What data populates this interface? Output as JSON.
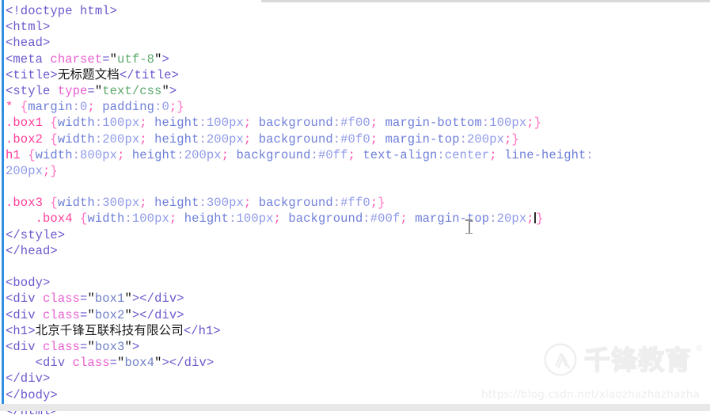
{
  "app": {
    "type": "code-editor",
    "language": "html",
    "theme": "light"
  },
  "code": {
    "lines": [
      {
        "id": "l1",
        "name": "code-line-doctype",
        "tokens": [
          {
            "t": "tag",
            "v": "<!doctype html>"
          }
        ]
      },
      {
        "id": "l2",
        "name": "code-line-html-open",
        "tokens": [
          {
            "t": "tag",
            "v": "<html>"
          }
        ]
      },
      {
        "id": "l3",
        "name": "code-line-head-open",
        "tokens": [
          {
            "t": "tag",
            "v": "<head>"
          }
        ]
      },
      {
        "id": "l4",
        "name": "code-line-meta-charset",
        "tokens": [
          {
            "t": "tag",
            "v": "<meta "
          },
          {
            "t": "attr",
            "v": "charset"
          },
          {
            "t": "tag",
            "v": "="
          },
          {
            "t": "quote",
            "v": "\""
          },
          {
            "t": "strgreen",
            "v": "utf-8"
          },
          {
            "t": "quote",
            "v": "\""
          },
          {
            "t": "tag",
            "v": ">"
          }
        ]
      },
      {
        "id": "l5",
        "name": "code-line-title",
        "tokens": [
          {
            "t": "tag",
            "v": "<title>"
          },
          {
            "t": "text",
            "v": "无标题文档"
          },
          {
            "t": "tag",
            "v": "</title>"
          }
        ]
      },
      {
        "id": "l6",
        "name": "code-line-style-open",
        "tokens": [
          {
            "t": "tag",
            "v": "<style "
          },
          {
            "t": "attr",
            "v": "type"
          },
          {
            "t": "tag",
            "v": "="
          },
          {
            "t": "quote",
            "v": "\""
          },
          {
            "t": "strgreen",
            "v": "text/css"
          },
          {
            "t": "quote",
            "v": "\""
          },
          {
            "t": "tag",
            "v": ">"
          }
        ]
      },
      {
        "id": "l7",
        "name": "code-line-css-universal",
        "tokens": [
          {
            "t": "sel",
            "v": "*"
          },
          {
            "t": "text",
            "v": " "
          },
          {
            "t": "brace",
            "v": "{"
          },
          {
            "t": "prop",
            "v": "margin"
          },
          {
            "t": "colon",
            "v": ":"
          },
          {
            "t": "val",
            "v": "0"
          },
          {
            "t": "semi",
            "v": ";"
          },
          {
            "t": "text",
            "v": " "
          },
          {
            "t": "prop",
            "v": "padding"
          },
          {
            "t": "colon",
            "v": ":"
          },
          {
            "t": "val",
            "v": "0"
          },
          {
            "t": "semi",
            "v": ";"
          },
          {
            "t": "brace",
            "v": "}"
          }
        ]
      },
      {
        "id": "l8",
        "name": "code-line-css-box1",
        "tokens": [
          {
            "t": "sel",
            "v": ".box1"
          },
          {
            "t": "text",
            "v": " "
          },
          {
            "t": "brace",
            "v": "{"
          },
          {
            "t": "prop",
            "v": "width"
          },
          {
            "t": "colon",
            "v": ":"
          },
          {
            "t": "val",
            "v": "100px"
          },
          {
            "t": "semi",
            "v": ";"
          },
          {
            "t": "text",
            "v": " "
          },
          {
            "t": "prop",
            "v": "height"
          },
          {
            "t": "colon",
            "v": ":"
          },
          {
            "t": "val",
            "v": "100px"
          },
          {
            "t": "semi",
            "v": ";"
          },
          {
            "t": "text",
            "v": " "
          },
          {
            "t": "prop",
            "v": "background"
          },
          {
            "t": "colon",
            "v": ":"
          },
          {
            "t": "val",
            "v": "#f00"
          },
          {
            "t": "semi",
            "v": ";"
          },
          {
            "t": "text",
            "v": " "
          },
          {
            "t": "prop",
            "v": "margin-bottom"
          },
          {
            "t": "colon",
            "v": ":"
          },
          {
            "t": "val",
            "v": "100px"
          },
          {
            "t": "semi",
            "v": ";"
          },
          {
            "t": "brace",
            "v": "}"
          }
        ]
      },
      {
        "id": "l9",
        "name": "code-line-css-box2",
        "tokens": [
          {
            "t": "sel",
            "v": ".box2"
          },
          {
            "t": "text",
            "v": " "
          },
          {
            "t": "brace",
            "v": "{"
          },
          {
            "t": "prop",
            "v": "width"
          },
          {
            "t": "colon",
            "v": ":"
          },
          {
            "t": "val",
            "v": "200px"
          },
          {
            "t": "semi",
            "v": ";"
          },
          {
            "t": "text",
            "v": " "
          },
          {
            "t": "prop",
            "v": "height"
          },
          {
            "t": "colon",
            "v": ":"
          },
          {
            "t": "val",
            "v": "200px"
          },
          {
            "t": "semi",
            "v": ";"
          },
          {
            "t": "text",
            "v": " "
          },
          {
            "t": "prop",
            "v": "background"
          },
          {
            "t": "colon",
            "v": ":"
          },
          {
            "t": "val",
            "v": "#0f0"
          },
          {
            "t": "semi",
            "v": ";"
          },
          {
            "t": "text",
            "v": " "
          },
          {
            "t": "prop",
            "v": "margin-top"
          },
          {
            "t": "colon",
            "v": ":"
          },
          {
            "t": "val",
            "v": "200px"
          },
          {
            "t": "semi",
            "v": ";"
          },
          {
            "t": "brace",
            "v": "}"
          }
        ]
      },
      {
        "id": "l10",
        "name": "code-line-css-h1-part1",
        "tokens": [
          {
            "t": "sel",
            "v": "h1"
          },
          {
            "t": "text",
            "v": " "
          },
          {
            "t": "brace",
            "v": "{"
          },
          {
            "t": "prop",
            "v": "width"
          },
          {
            "t": "colon",
            "v": ":"
          },
          {
            "t": "val",
            "v": "800px"
          },
          {
            "t": "semi",
            "v": ";"
          },
          {
            "t": "text",
            "v": " "
          },
          {
            "t": "prop",
            "v": "height"
          },
          {
            "t": "colon",
            "v": ":"
          },
          {
            "t": "val",
            "v": "200px"
          },
          {
            "t": "semi",
            "v": ";"
          },
          {
            "t": "text",
            "v": " "
          },
          {
            "t": "prop",
            "v": "background"
          },
          {
            "t": "colon",
            "v": ":"
          },
          {
            "t": "val",
            "v": "#0ff"
          },
          {
            "t": "semi",
            "v": ";"
          },
          {
            "t": "text",
            "v": " "
          },
          {
            "t": "prop",
            "v": "text-align"
          },
          {
            "t": "colon",
            "v": ":"
          },
          {
            "t": "val",
            "v": "center"
          },
          {
            "t": "semi",
            "v": ";"
          },
          {
            "t": "text",
            "v": " "
          },
          {
            "t": "prop",
            "v": "line-height"
          },
          {
            "t": "colon",
            "v": ":"
          }
        ]
      },
      {
        "id": "l11",
        "name": "code-line-css-h1-part2",
        "tokens": [
          {
            "t": "val",
            "v": "200px"
          },
          {
            "t": "semi",
            "v": ";"
          },
          {
            "t": "brace",
            "v": "}"
          }
        ]
      },
      {
        "id": "l12",
        "name": "code-line-blank-1",
        "tokens": []
      },
      {
        "id": "l13",
        "name": "code-line-css-box3",
        "tokens": [
          {
            "t": "sel",
            "v": ".box3"
          },
          {
            "t": "text",
            "v": " "
          },
          {
            "t": "brace",
            "v": "{"
          },
          {
            "t": "prop",
            "v": "width"
          },
          {
            "t": "colon",
            "v": ":"
          },
          {
            "t": "val",
            "v": "300px"
          },
          {
            "t": "semi",
            "v": ";"
          },
          {
            "t": "text",
            "v": " "
          },
          {
            "t": "prop",
            "v": "height"
          },
          {
            "t": "colon",
            "v": ":"
          },
          {
            "t": "val",
            "v": "300px"
          },
          {
            "t": "semi",
            "v": ";"
          },
          {
            "t": "text",
            "v": " "
          },
          {
            "t": "prop",
            "v": "background"
          },
          {
            "t": "colon",
            "v": ":"
          },
          {
            "t": "val",
            "v": "#ff0"
          },
          {
            "t": "semi",
            "v": ";"
          },
          {
            "t": "brace",
            "v": "}"
          }
        ]
      },
      {
        "id": "l14",
        "name": "code-line-css-box4",
        "tokens": [
          {
            "t": "text",
            "v": "    "
          },
          {
            "t": "sel",
            "v": ".box4"
          },
          {
            "t": "text",
            "v": " "
          },
          {
            "t": "brace",
            "v": "{"
          },
          {
            "t": "prop",
            "v": "width"
          },
          {
            "t": "colon",
            "v": ":"
          },
          {
            "t": "val",
            "v": "100px"
          },
          {
            "t": "semi",
            "v": ";"
          },
          {
            "t": "text",
            "v": " "
          },
          {
            "t": "prop",
            "v": "height"
          },
          {
            "t": "colon",
            "v": ":"
          },
          {
            "t": "val",
            "v": "100px"
          },
          {
            "t": "semi",
            "v": ";"
          },
          {
            "t": "text",
            "v": " "
          },
          {
            "t": "prop",
            "v": "background"
          },
          {
            "t": "colon",
            "v": ":"
          },
          {
            "t": "val",
            "v": "#00f"
          },
          {
            "t": "semi",
            "v": ";"
          },
          {
            "t": "text",
            "v": " "
          },
          {
            "t": "prop",
            "v": "margin-top"
          },
          {
            "t": "colon",
            "v": ":"
          },
          {
            "t": "val",
            "v": "20px"
          },
          {
            "t": "semi",
            "v": ";"
          },
          {
            "t": "caret",
            "v": ""
          },
          {
            "t": "brace",
            "v": "}"
          }
        ]
      },
      {
        "id": "l15",
        "name": "code-line-style-close",
        "tokens": [
          {
            "t": "tag",
            "v": "</style>"
          }
        ]
      },
      {
        "id": "l16",
        "name": "code-line-head-close",
        "tokens": [
          {
            "t": "tag",
            "v": "</head>"
          }
        ]
      },
      {
        "id": "l17",
        "name": "code-line-blank-2",
        "tokens": []
      },
      {
        "id": "l18",
        "name": "code-line-body-open",
        "tokens": [
          {
            "t": "tag",
            "v": "<body>"
          }
        ]
      },
      {
        "id": "l19",
        "name": "code-line-div-box1",
        "tokens": [
          {
            "t": "tag",
            "v": "<div "
          },
          {
            "t": "attr",
            "v": "class"
          },
          {
            "t": "tag",
            "v": "="
          },
          {
            "t": "quote",
            "v": "\""
          },
          {
            "t": "strblue",
            "v": "box1"
          },
          {
            "t": "quote",
            "v": "\""
          },
          {
            "t": "tag",
            "v": "></div>"
          }
        ]
      },
      {
        "id": "l20",
        "name": "code-line-div-box2",
        "tokens": [
          {
            "t": "tag",
            "v": "<div "
          },
          {
            "t": "attr",
            "v": "class"
          },
          {
            "t": "tag",
            "v": "="
          },
          {
            "t": "quote",
            "v": "\""
          },
          {
            "t": "strblue",
            "v": "box2"
          },
          {
            "t": "quote",
            "v": "\""
          },
          {
            "t": "tag",
            "v": "></div>"
          }
        ]
      },
      {
        "id": "l21",
        "name": "code-line-h1-content",
        "tokens": [
          {
            "t": "tag",
            "v": "<h1>"
          },
          {
            "t": "text",
            "v": "北京千锋互联科技有限公司"
          },
          {
            "t": "tag",
            "v": "</h1>"
          }
        ]
      },
      {
        "id": "l22",
        "name": "code-line-div-box3-open",
        "tokens": [
          {
            "t": "tag",
            "v": "<div "
          },
          {
            "t": "attr",
            "v": "class"
          },
          {
            "t": "tag",
            "v": "="
          },
          {
            "t": "quote",
            "v": "\""
          },
          {
            "t": "strblue",
            "v": "box3"
          },
          {
            "t": "quote",
            "v": "\""
          },
          {
            "t": "tag",
            "v": ">"
          }
        ]
      },
      {
        "id": "l23",
        "name": "code-line-div-box4",
        "tokens": [
          {
            "t": "text",
            "v": "    "
          },
          {
            "t": "tag",
            "v": "<div "
          },
          {
            "t": "attr",
            "v": "class"
          },
          {
            "t": "tag",
            "v": "="
          },
          {
            "t": "quote",
            "v": "\""
          },
          {
            "t": "strblue",
            "v": "box4"
          },
          {
            "t": "quote",
            "v": "\""
          },
          {
            "t": "tag",
            "v": "></div>"
          }
        ]
      },
      {
        "id": "l24",
        "name": "code-line-div-box3-close",
        "tokens": [
          {
            "t": "tag",
            "v": "</div>"
          }
        ]
      },
      {
        "id": "l25",
        "name": "code-line-body-close",
        "tokens": [
          {
            "t": "tag",
            "v": "</body>"
          }
        ]
      },
      {
        "id": "l26",
        "name": "code-line-html-close",
        "tokens": [
          {
            "t": "tag",
            "v": "</html>"
          }
        ]
      }
    ]
  },
  "watermark": {
    "brand_text": "千锋教育",
    "trademark": "®",
    "url": "https://blog.csdn.net/xiaozhazhazhazha"
  },
  "colors": {
    "gutter_rule": "#2f8fe0",
    "tag": "#6a5acd",
    "attribute": "#e75fd0",
    "string_green": "#5aa86a",
    "string_blue": "#6f7fc7",
    "selector": "#ff3f9a",
    "brace": "#ff6fc4",
    "property": "#6f7fd8",
    "value": "#8f9ae8",
    "semicolon": "#ff4fb0",
    "background": "#ffffff"
  }
}
